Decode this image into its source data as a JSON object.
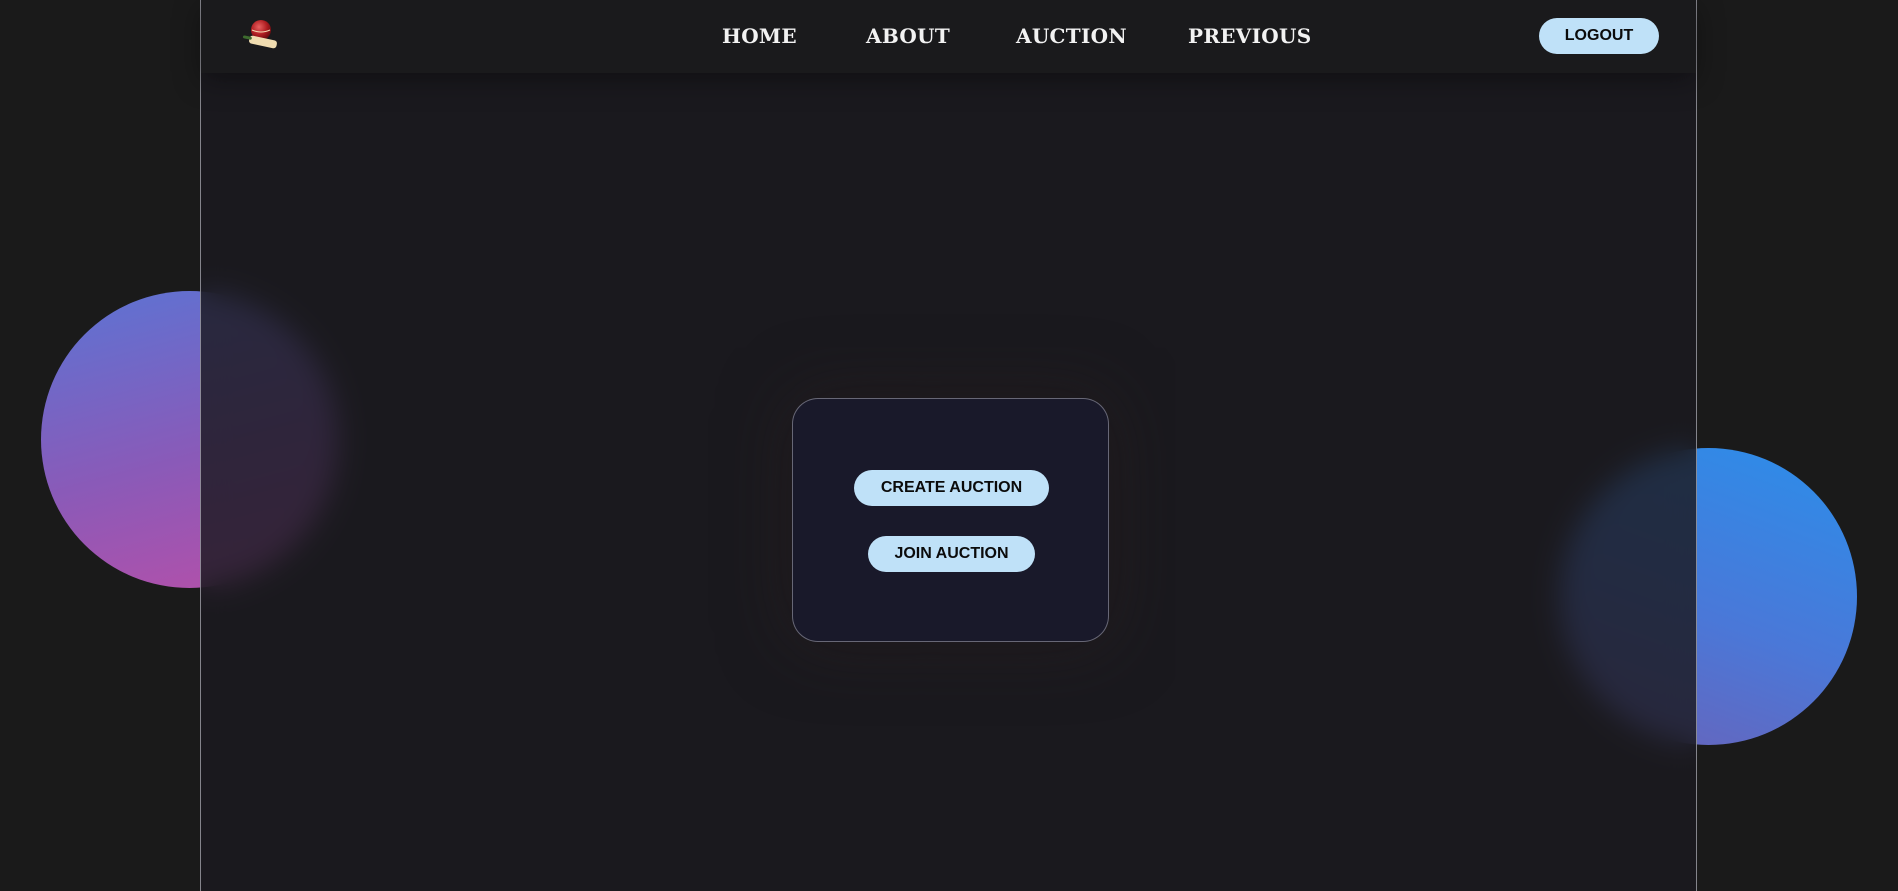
{
  "navbar": {
    "logo_icon": "cricket-ball-bat-icon",
    "links": [
      {
        "label": "HOME"
      },
      {
        "label": "ABOUT"
      },
      {
        "label": "AUCTION"
      },
      {
        "label": "PREVIOUS"
      }
    ],
    "logout_label": "LOGOUT"
  },
  "card": {
    "create_label": "CREATE AUCTION",
    "join_label": "JOIN AUCTION"
  },
  "colors": {
    "background": "#1a1a1a",
    "panel": "#1b1a20",
    "button": "#bfe1f8",
    "button_text": "#0b0b0b",
    "nav_text": "#f2f2f2",
    "blob_left": [
      "#5b74d4",
      "#b84fa8"
    ],
    "blob_right": [
      "#2b8eea",
      "#6b62b8"
    ]
  }
}
